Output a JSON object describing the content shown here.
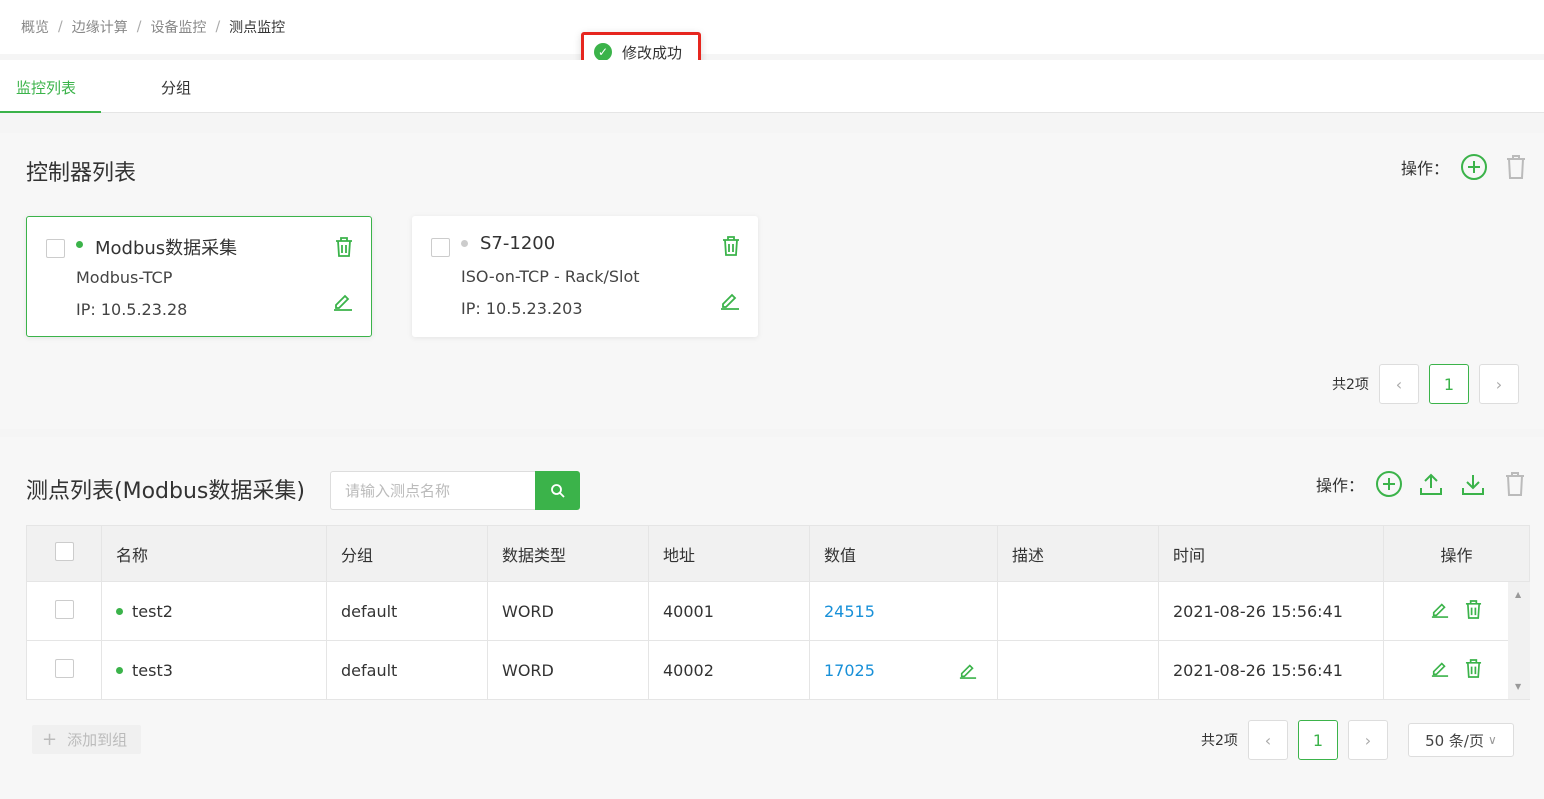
{
  "breadcrumb": [
    "概览",
    "边缘计算",
    "设备监控",
    "测点监控"
  ],
  "toast": "修改成功",
  "tabs": [
    {
      "label": "监控列表",
      "active": true
    },
    {
      "label": "分组",
      "active": false
    }
  ],
  "controllers": {
    "title": "控制器列表",
    "ops_label": "操作：",
    "cards": [
      {
        "name": "Modbus数据采集",
        "protocol": "Modbus-TCP",
        "ip": "IP: 10.5.23.28",
        "status_color": "#3bb34a",
        "selected": true
      },
      {
        "name": "S7-1200",
        "protocol": "ISO-on-TCP - Rack/Slot",
        "ip": "IP: 10.5.23.203",
        "status_color": "#cccccc",
        "selected": false
      }
    ],
    "pager": {
      "total": "共2项",
      "page": "1"
    }
  },
  "points": {
    "title": "测点列表(Modbus数据采集)",
    "search_placeholder": "请输入测点名称",
    "ops_label": "操作：",
    "columns": [
      "名称",
      "分组",
      "数据类型",
      "地址",
      "数值",
      "描述",
      "时间",
      "操作"
    ],
    "rows": [
      {
        "name": "test2",
        "group": "default",
        "type": "WORD",
        "address": "40001",
        "value": "24515",
        "desc": "",
        "time": "2021-08-26 15:56:41"
      },
      {
        "name": "test3",
        "group": "default",
        "type": "WORD",
        "address": "40002",
        "value": "17025",
        "desc": "",
        "time": "2021-08-26 15:56:41"
      }
    ],
    "add_group": "添加到组",
    "pager": {
      "total": "共2项",
      "page": "1",
      "page_size": "50 条/页"
    }
  },
  "colors": {
    "accent": "#3bb34a",
    "value_link": "#1890d8",
    "toast_border": "#e6261f"
  }
}
